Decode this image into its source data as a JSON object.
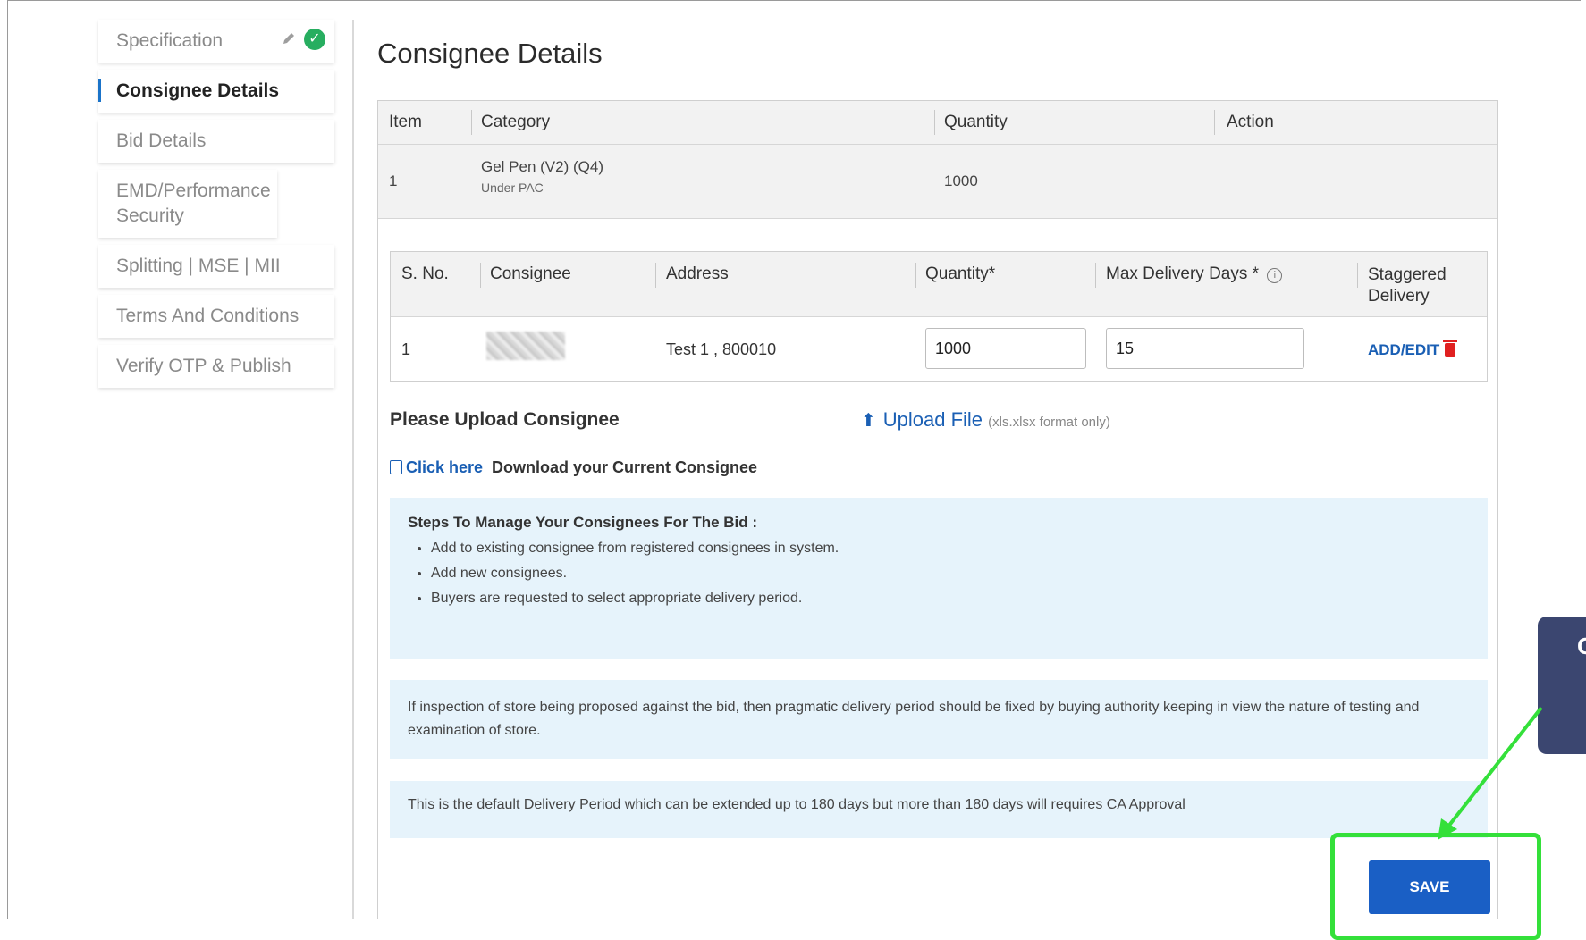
{
  "sidebar": {
    "items": [
      {
        "label": "Specification",
        "state": "done"
      },
      {
        "label": "Consignee Details",
        "state": "active"
      },
      {
        "label": "Bid Details",
        "state": "default"
      },
      {
        "label": "EMD/Performance Security",
        "state": "default"
      },
      {
        "label": "Splitting | MSE | MII",
        "state": "default"
      },
      {
        "label": "Terms And Conditions",
        "state": "default"
      },
      {
        "label": "Verify OTP & Publish",
        "state": "default"
      }
    ],
    "done_icon": "check-circle-icon",
    "edit_icon": "pencil-icon"
  },
  "page": {
    "title": "Consignee Details"
  },
  "item_table": {
    "headers": [
      "Item",
      "Category",
      "Quantity",
      "Action"
    ],
    "rows": [
      {
        "item": "1",
        "category": "Gel Pen (V2)  (Q4)",
        "sub": "Under PAC",
        "quantity": "1000",
        "action": ""
      }
    ]
  },
  "consignee_table": {
    "headers": [
      "S. No.",
      "Consignee",
      "Address",
      "Quantity*",
      "Max Delivery Days *",
      "Staggered Delivery"
    ],
    "info_icon": "info-icon",
    "rows": [
      {
        "sno": "1",
        "consignee": "",
        "address": "Test 1 , 800010",
        "quantity": "1000",
        "max_days": "15",
        "action_label": "ADD/EDIT"
      }
    ]
  },
  "upload": {
    "label": "Please Upload Consignee",
    "link": "Upload File",
    "note": "(xls.xlsx format only)",
    "click_here": "Click here",
    "download_text": "Download your Current Consignee"
  },
  "steps": {
    "title": "Steps To Manage Your Consignees For The Bid :",
    "items": [
      "Add to existing consignee from registered consignees in system.",
      "Add new consignees.",
      "Buyers are requested to select appropriate delivery period."
    ]
  },
  "notes": {
    "inspection": "If inspection of store being proposed against the bid, then pragmatic delivery period should be fixed by buying authority keeping in view the nature of testing and examination of store.",
    "default_period": "This is the default Delivery Period which can be extended up to 180 days but more than 180 days will requires CA Approval"
  },
  "actions": {
    "save": "SAVE"
  },
  "annotation": {
    "callout_text": "C",
    "highlight_color": "#34e03a",
    "callout_color": "#3b4670"
  },
  "colors": {
    "accent": "#1a5fc5",
    "success": "#27ae60",
    "danger": "#e02020",
    "info_bg": "#e6f3fb"
  }
}
